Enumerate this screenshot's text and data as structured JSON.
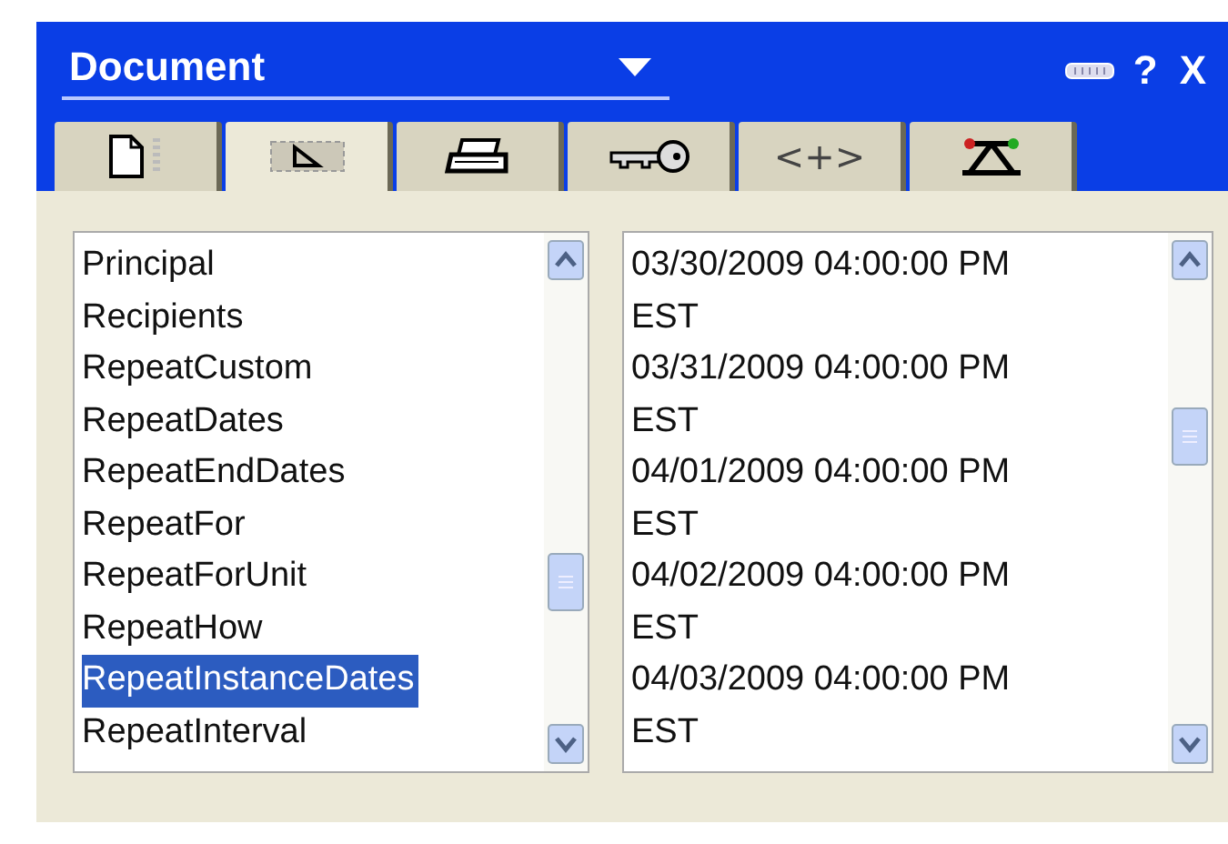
{
  "header": {
    "title": "Document",
    "help": "?",
    "close": "X"
  },
  "tabs": [
    {
      "kind": "page",
      "selected": false
    },
    {
      "kind": "ruler",
      "selected": true
    },
    {
      "kind": "printer",
      "selected": false
    },
    {
      "kind": "key",
      "selected": false
    },
    {
      "kind": "text",
      "label": "<+>",
      "selected": false
    },
    {
      "kind": "network",
      "selected": false
    }
  ],
  "field_list": [
    {
      "label": "Principal",
      "selected": false
    },
    {
      "label": "Recipients",
      "selected": false
    },
    {
      "label": "RepeatCustom",
      "selected": false
    },
    {
      "label": "RepeatDates",
      "selected": false
    },
    {
      "label": "RepeatEndDates",
      "selected": false
    },
    {
      "label": "RepeatFor",
      "selected": false
    },
    {
      "label": "RepeatForUnit",
      "selected": false
    },
    {
      "label": "RepeatHow",
      "selected": false
    },
    {
      "label": "RepeatInstanceDates",
      "selected": true
    },
    {
      "label": "RepeatInterval",
      "selected": false
    }
  ],
  "value_list": [
    {
      "lines": [
        "03/30/2009 04:00:00 PM",
        "EST"
      ]
    },
    {
      "lines": [
        "03/31/2009 04:00:00 PM",
        "EST"
      ]
    },
    {
      "lines": [
        "04/01/2009 04:00:00 PM",
        "EST"
      ]
    },
    {
      "lines": [
        "04/02/2009 04:00:00 PM",
        "EST"
      ]
    },
    {
      "lines": [
        "04/03/2009 04:00:00 PM",
        "EST"
      ]
    }
  ]
}
